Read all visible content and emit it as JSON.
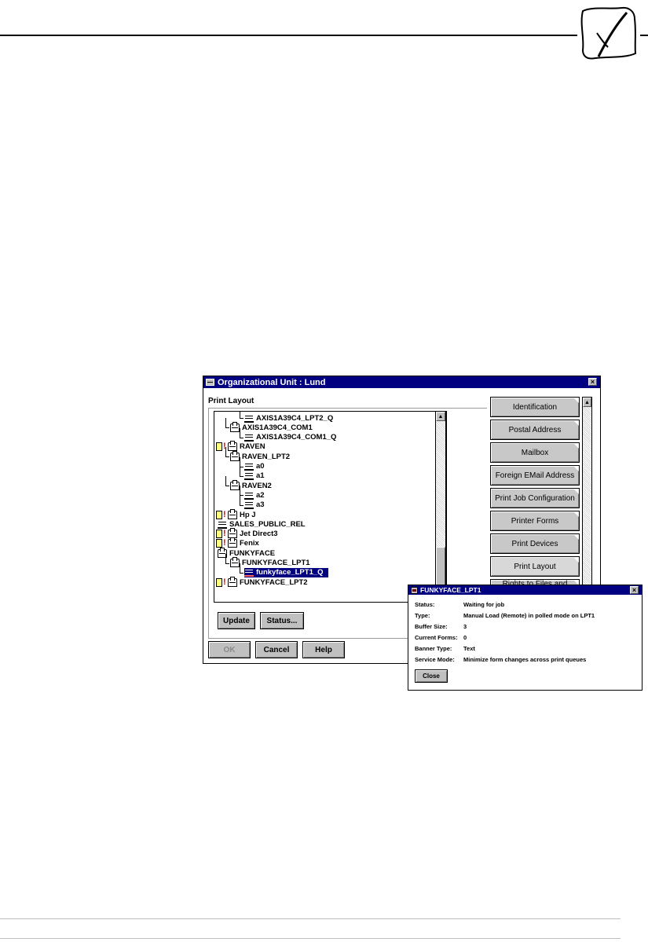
{
  "main_window": {
    "title": "Organizational Unit : Lund",
    "close_glyph": "×",
    "section_label": "Print Layout",
    "tree": [
      {
        "label": "AXIS1A39C4_LPT2_Q",
        "type": "queue",
        "depth": 3
      },
      {
        "label": "AXIS1A39C4_COM1",
        "type": "printer",
        "depth": 2
      },
      {
        "label": "AXIS1A39C4_COM1_Q",
        "type": "queue",
        "depth": 3
      },
      {
        "label": "RAVEN",
        "type": "server-alert",
        "depth": 1
      },
      {
        "label": "RAVEN_LPT2",
        "type": "printer",
        "depth": 2
      },
      {
        "label": "a0",
        "type": "queue",
        "depth": 3
      },
      {
        "label": "a1",
        "type": "queue",
        "depth": 3
      },
      {
        "label": "RAVEN2",
        "type": "printer",
        "depth": 2
      },
      {
        "label": "a2",
        "type": "queue",
        "depth": 3
      },
      {
        "label": "a3",
        "type": "queue",
        "depth": 3
      },
      {
        "label": "Hp J",
        "type": "server-alert",
        "depth": 1
      },
      {
        "label": "SALES_PUBLIC_REL",
        "type": "queue",
        "depth": 1
      },
      {
        "label": "Jet Direct3",
        "type": "server-alert",
        "depth": 1
      },
      {
        "label": "Fenix",
        "type": "server",
        "depth": 1
      },
      {
        "label": "FUNKYFACE",
        "type": "printer",
        "depth": 1
      },
      {
        "label": "FUNKYFACE_LPT1",
        "type": "printer",
        "depth": 2
      },
      {
        "label": "funkyface_LPT1_Q",
        "type": "queue",
        "depth": 3,
        "selected": true
      },
      {
        "label": "FUNKYFACE_LPT2",
        "type": "printer-alert",
        "depth": 2
      }
    ],
    "buttons": {
      "update": "Update",
      "status": "Status...",
      "ok": "OK",
      "cancel": "Cancel",
      "help": "Help"
    },
    "side_pages": [
      "Identification",
      "Postal Address",
      "Mailbox",
      "Foreign EMail Address",
      "Print Job Configuration",
      "Printer Forms",
      "Print Devices",
      "Print Layout",
      "Rights to Files and"
    ],
    "active_page": "Print Layout"
  },
  "status_window": {
    "title": "FUNKYFACE_LPT1",
    "close_glyph": "×",
    "fields": [
      {
        "label": "Status:",
        "value": "Waiting for job"
      },
      {
        "label": "Type:",
        "value": "Manual Load (Remote) in polled mode on LPT1"
      },
      {
        "label": "Buffer Size:",
        "value": "3"
      },
      {
        "label": "Current Forms:",
        "value": "0"
      },
      {
        "label": "Banner Type:",
        "value": "Text"
      },
      {
        "label": "Service Mode:",
        "value": "Minimize form changes across print queues"
      }
    ],
    "close_button": "Close"
  }
}
